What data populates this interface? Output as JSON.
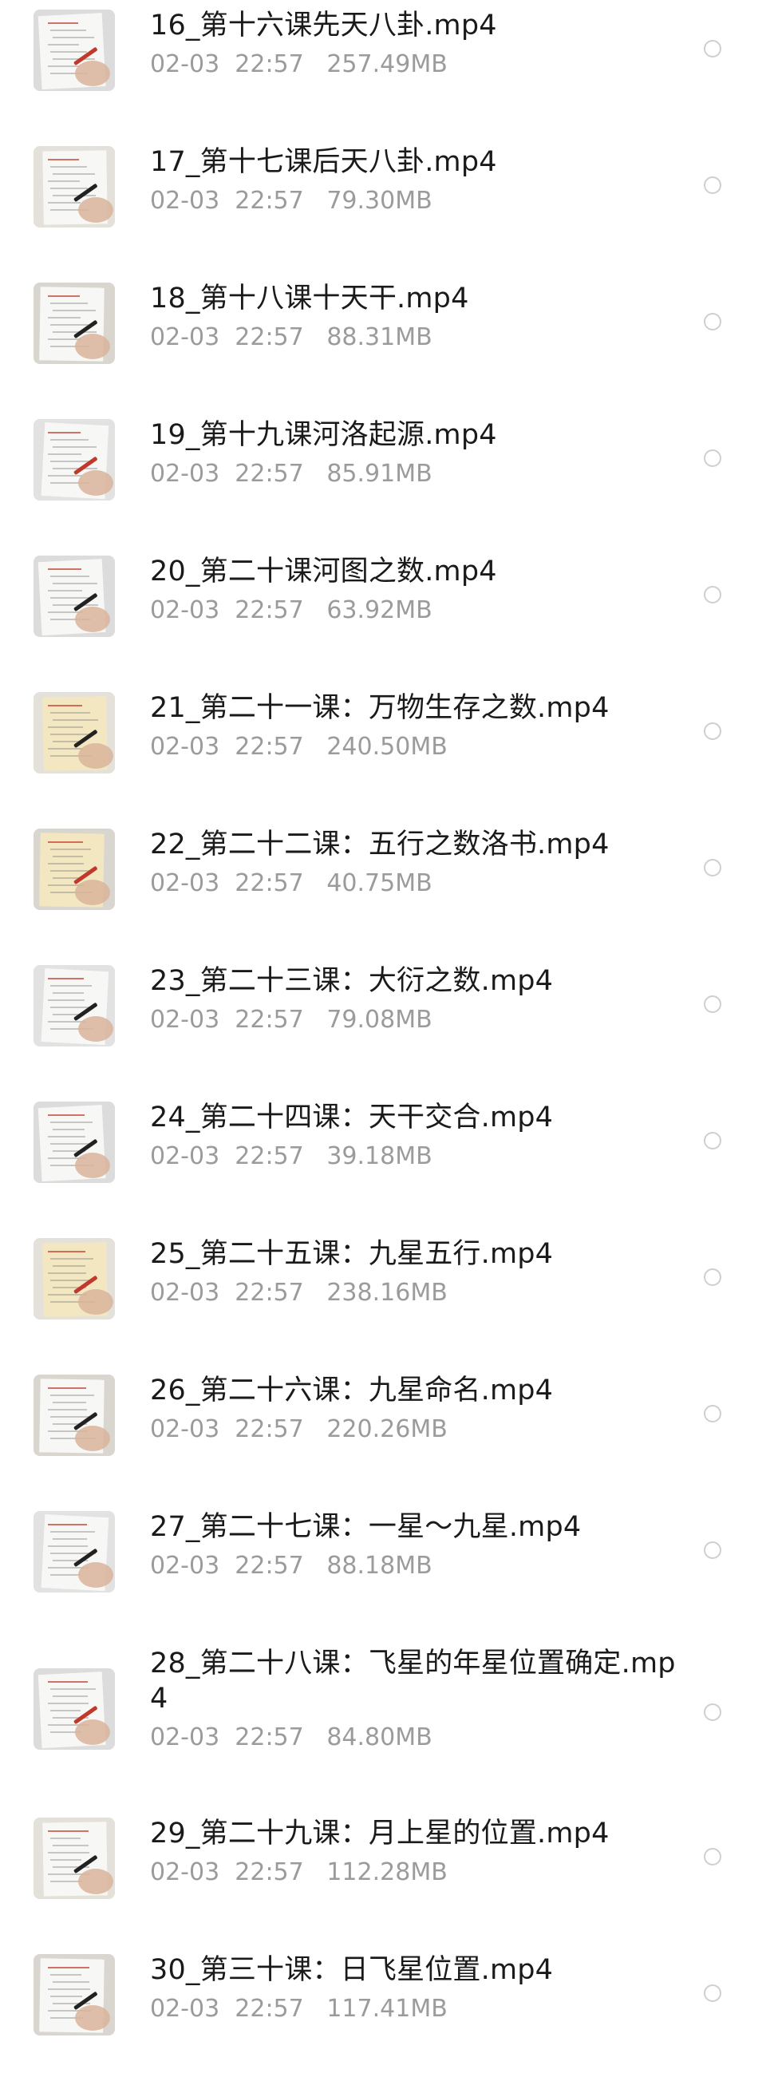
{
  "files": [
    {
      "name": "16_第十六课先天八卦.mp4",
      "date": "02-03",
      "time": "22:57",
      "size": "257.49MB",
      "thumb_icon": "video-thumbnail-icon"
    },
    {
      "name": "17_第十七课后天八卦.mp4",
      "date": "02-03",
      "time": "22:57",
      "size": "79.30MB",
      "thumb_icon": "video-thumbnail-icon"
    },
    {
      "name": "18_第十八课十天干.mp4",
      "date": "02-03",
      "time": "22:57",
      "size": "88.31MB",
      "thumb_icon": "video-thumbnail-icon"
    },
    {
      "name": "19_第十九课河洛起源.mp4",
      "date": "02-03",
      "time": "22:57",
      "size": "85.91MB",
      "thumb_icon": "video-thumbnail-icon"
    },
    {
      "name": "20_第二十课河图之数.mp4",
      "date": "02-03",
      "time": "22:57",
      "size": "63.92MB",
      "thumb_icon": "video-thumbnail-icon"
    },
    {
      "name": "21_第二十一课：万物生存之数.mp4",
      "date": "02-03",
      "time": "22:57",
      "size": "240.50MB",
      "thumb_icon": "video-thumbnail-icon"
    },
    {
      "name": "22_第二十二课：五行之数洛书.mp4",
      "date": "02-03",
      "time": "22:57",
      "size": "40.75MB",
      "thumb_icon": "video-thumbnail-icon"
    },
    {
      "name": "23_第二十三课：大衍之数.mp4",
      "date": "02-03",
      "time": "22:57",
      "size": "79.08MB",
      "thumb_icon": "video-thumbnail-icon"
    },
    {
      "name": "24_第二十四课：天干交合.mp4",
      "date": "02-03",
      "time": "22:57",
      "size": "39.18MB",
      "thumb_icon": "video-thumbnail-icon"
    },
    {
      "name": "25_第二十五课：九星五行.mp4",
      "date": "02-03",
      "time": "22:57",
      "size": "238.16MB",
      "thumb_icon": "video-thumbnail-icon"
    },
    {
      "name": "26_第二十六课：九星命名.mp4",
      "date": "02-03",
      "time": "22:57",
      "size": "220.26MB",
      "thumb_icon": "video-thumbnail-icon"
    },
    {
      "name": "27_第二十七课：一星～九星.mp4",
      "date": "02-03",
      "time": "22:57",
      "size": "88.18MB",
      "thumb_icon": "video-thumbnail-icon"
    },
    {
      "name": "28_第二十八课：飞星的年星位置确定.mp4",
      "date": "02-03",
      "time": "22:57",
      "size": "84.80MB",
      "thumb_icon": "video-thumbnail-icon"
    },
    {
      "name": "29_第二十九课：月上星的位置.mp4",
      "date": "02-03",
      "time": "22:57",
      "size": "112.28MB",
      "thumb_icon": "video-thumbnail-icon"
    },
    {
      "name": "30_第三十课：日飞星位置.mp4",
      "date": "02-03",
      "time": "22:57",
      "size": "117.41MB",
      "thumb_icon": "video-thumbnail-icon"
    }
  ],
  "colors": {
    "background": "#ffffff",
    "name_text": "#1a1a1a",
    "meta_text": "#9b9b9b",
    "radio_border": "#cfcfcf"
  }
}
